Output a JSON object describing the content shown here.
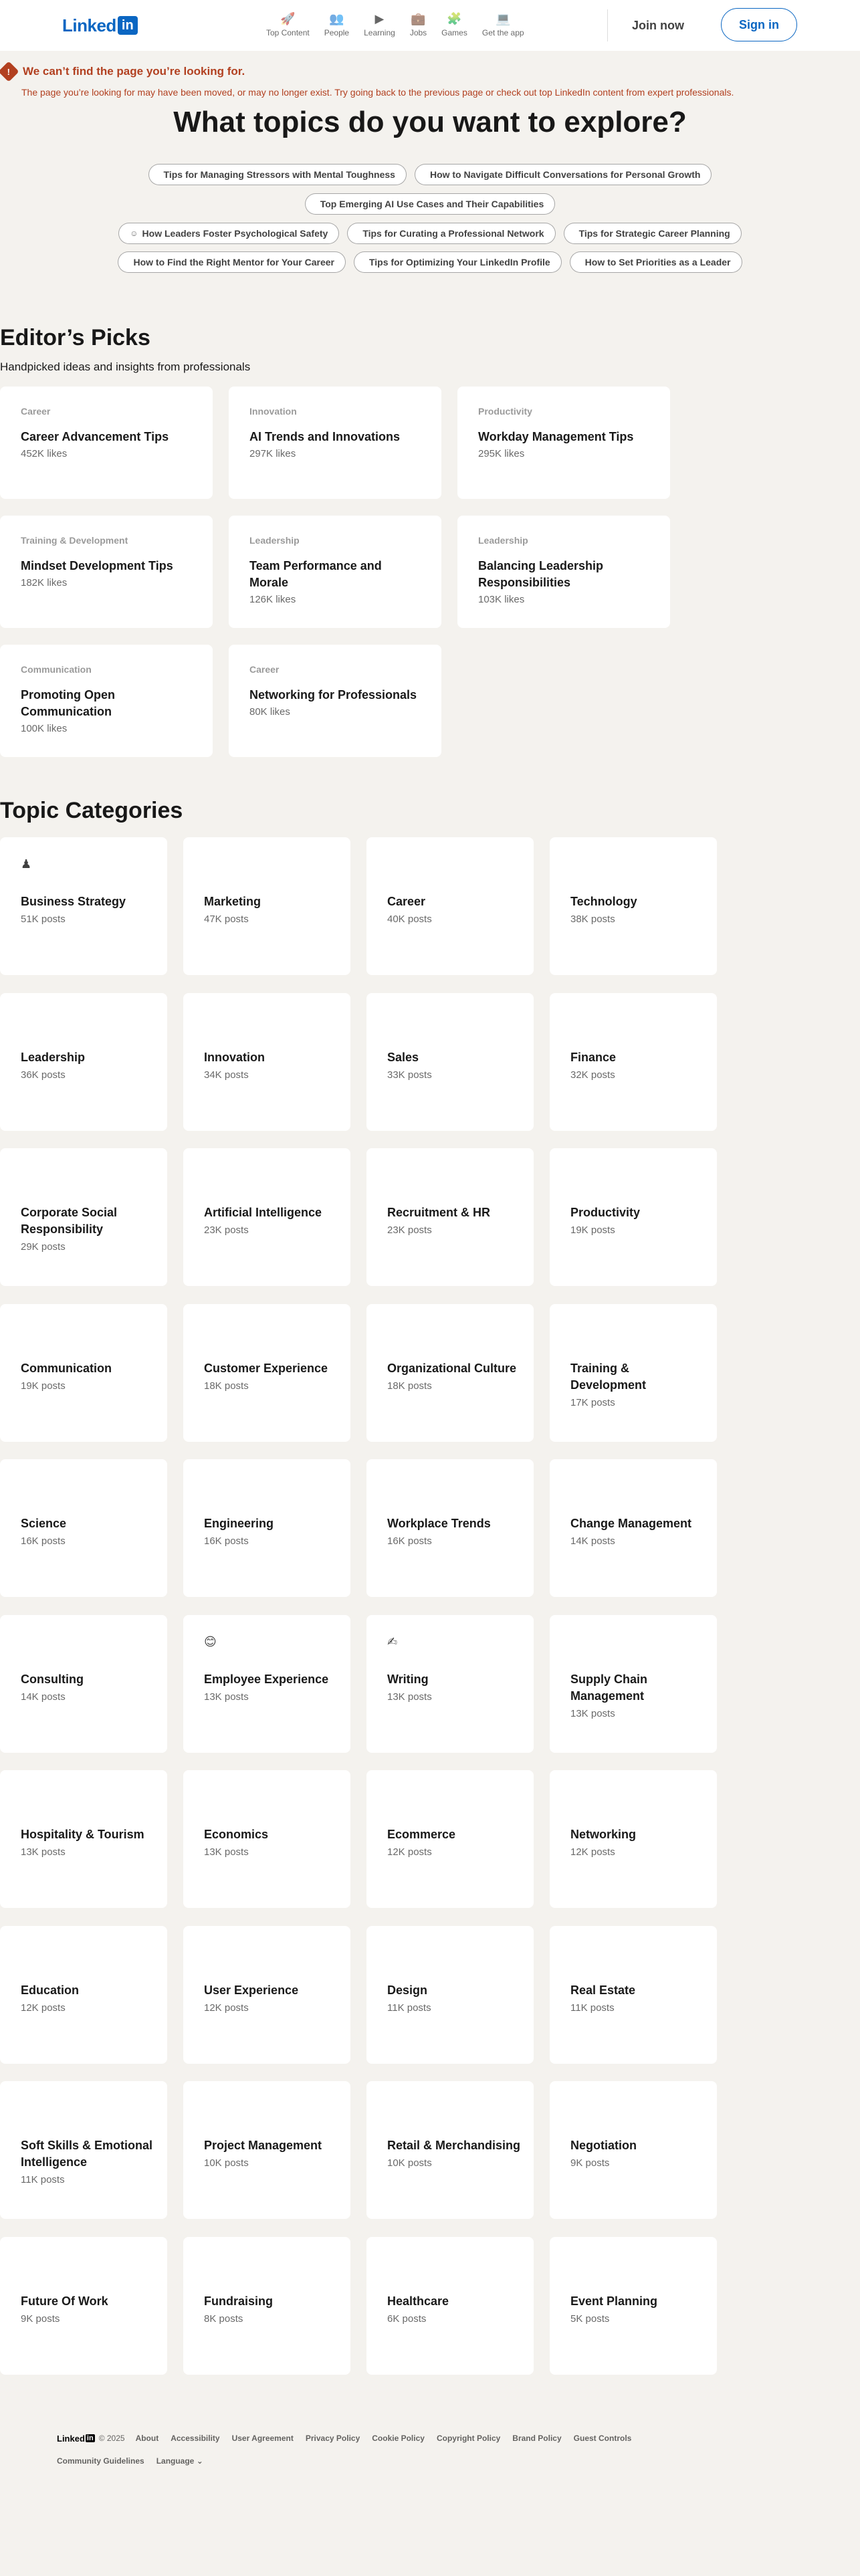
{
  "header": {
    "logo_text": "Linked",
    "logo_box": "in",
    "nav": [
      {
        "label": "Top Content",
        "icon": "rocket-icon",
        "glyph": "🚀"
      },
      {
        "label": "People",
        "icon": "people-icon",
        "glyph": "👥"
      },
      {
        "label": "Learning",
        "icon": "learning-icon",
        "glyph": "▶"
      },
      {
        "label": "Jobs",
        "icon": "briefcase-icon",
        "glyph": "💼"
      },
      {
        "label": "Games",
        "icon": "puzzle-icon",
        "glyph": "🧩"
      },
      {
        "label": "Get the app",
        "icon": "laptop-icon",
        "glyph": "💻"
      }
    ],
    "join_label": "Join now",
    "signin_label": "Sign in"
  },
  "error": {
    "badge": "!",
    "title": "We can’t find the page you’re looking for.",
    "message": "The page you’re looking for may have been moved, or may no longer exist. Try going back to the previous page or check out top LinkedIn content from expert professionals."
  },
  "explore": {
    "heading": "What topics do you want to explore?",
    "pills": [
      [
        "Tips for Managing Stressors with Mental Toughness",
        "How to Navigate Difficult Conversations for Personal Growth"
      ],
      [
        "Top Emerging AI Use Cases and Their Capabilities"
      ],
      [
        "How Leaders Foster Psychological Safety",
        "Tips for Curating a Professional Network",
        "Tips for Strategic Career Planning"
      ],
      [
        "How to Find the Right Mentor for Your Career",
        "Tips for Optimizing Your LinkedIn Profile",
        "How to Set Priorities as a Leader"
      ]
    ],
    "pill_icons": [
      [
        "",
        ""
      ],
      [
        ""
      ],
      [
        "☺",
        "",
        ""
      ],
      [
        "",
        "",
        ""
      ]
    ]
  },
  "editors_picks": {
    "title": "Editor’s Picks",
    "subtitle": "Handpicked ideas and insights from professionals",
    "bookmark_glyph": "",
    "cards": [
      {
        "category": "Career",
        "title": "Career Advancement Tips",
        "likes": "452K likes"
      },
      {
        "category": "Innovation",
        "title": "AI Trends and Innovations",
        "likes": "297K likes"
      },
      {
        "category": "Productivity",
        "title": "Workday Management Tips",
        "likes": "295K likes"
      },
      {
        "category": "Training & Development",
        "title": "Mindset Development Tips",
        "likes": "182K likes"
      },
      {
        "category": "Leadership",
        "title": "Team Performance and Morale",
        "likes": "126K likes"
      },
      {
        "category": "Leadership",
        "title": "Balancing Leadership Responsibilities",
        "likes": "103K likes"
      },
      {
        "category": "Communication",
        "title": "Promoting Open Communication",
        "likes": "100K likes"
      },
      {
        "category": "Career",
        "title": "Networking for Professionals",
        "likes": "80K likes"
      }
    ]
  },
  "topics": {
    "title": "Topic Categories",
    "items": [
      {
        "name": "Business Strategy",
        "posts": "51K posts",
        "glyph": "♟"
      },
      {
        "name": "Marketing",
        "posts": "47K posts",
        "glyph": ""
      },
      {
        "name": "Career",
        "posts": "40K posts",
        "glyph": ""
      },
      {
        "name": "Technology",
        "posts": "38K posts",
        "glyph": ""
      },
      {
        "name": "Leadership",
        "posts": "36K posts",
        "glyph": ""
      },
      {
        "name": "Innovation",
        "posts": "34K posts",
        "glyph": ""
      },
      {
        "name": "Sales",
        "posts": "33K posts",
        "glyph": ""
      },
      {
        "name": "Finance",
        "posts": "32K posts",
        "glyph": ""
      },
      {
        "name": "Corporate Social Responsibility",
        "posts": "29K posts",
        "glyph": ""
      },
      {
        "name": "Artificial Intelligence",
        "posts": "23K posts",
        "glyph": ""
      },
      {
        "name": "Recruitment & HR",
        "posts": "23K posts",
        "glyph": ""
      },
      {
        "name": "Productivity",
        "posts": "19K posts",
        "glyph": ""
      },
      {
        "name": "Communication",
        "posts": "19K posts",
        "glyph": ""
      },
      {
        "name": "Customer Experience",
        "posts": "18K posts",
        "glyph": ""
      },
      {
        "name": "Organizational Culture",
        "posts": "18K posts",
        "glyph": ""
      },
      {
        "name": "Training & Development",
        "posts": "17K posts",
        "glyph": ""
      },
      {
        "name": "Science",
        "posts": "16K posts",
        "glyph": ""
      },
      {
        "name": "Engineering",
        "posts": "16K posts",
        "glyph": ""
      },
      {
        "name": "Workplace Trends",
        "posts": "16K posts",
        "glyph": ""
      },
      {
        "name": "Change Management",
        "posts": "14K posts",
        "glyph": ""
      },
      {
        "name": "Consulting",
        "posts": "14K posts",
        "glyph": ""
      },
      {
        "name": "Employee Experience",
        "posts": "13K posts",
        "glyph": "😊"
      },
      {
        "name": "Writing",
        "posts": "13K posts",
        "glyph": "✍"
      },
      {
        "name": "Supply Chain Management",
        "posts": "13K posts",
        "glyph": ""
      },
      {
        "name": "Hospitality & Tourism",
        "posts": "13K posts",
        "glyph": ""
      },
      {
        "name": "Economics",
        "posts": "13K posts",
        "glyph": ""
      },
      {
        "name": "Ecommerce",
        "posts": "12K posts",
        "glyph": ""
      },
      {
        "name": "Networking",
        "posts": "12K posts",
        "glyph": ""
      },
      {
        "name": "Education",
        "posts": "12K posts",
        "glyph": ""
      },
      {
        "name": "User Experience",
        "posts": "12K posts",
        "glyph": ""
      },
      {
        "name": "Design",
        "posts": "11K posts",
        "glyph": ""
      },
      {
        "name": "Real Estate",
        "posts": "11K posts",
        "glyph": ""
      },
      {
        "name": "Soft Skills & Emotional Intelligence",
        "posts": "11K posts",
        "glyph": ""
      },
      {
        "name": "Project Management",
        "posts": "10K posts",
        "glyph": ""
      },
      {
        "name": "Retail & Merchandising",
        "posts": "10K posts",
        "glyph": ""
      },
      {
        "name": "Negotiation",
        "posts": "9K posts",
        "glyph": ""
      },
      {
        "name": "Future Of Work",
        "posts": "9K posts",
        "glyph": ""
      },
      {
        "name": "Fundraising",
        "posts": "8K posts",
        "glyph": ""
      },
      {
        "name": "Healthcare",
        "posts": "6K posts",
        "glyph": ""
      },
      {
        "name": "Event Planning",
        "posts": "5K posts",
        "glyph": ""
      }
    ]
  },
  "footer": {
    "logo_text": "Linked",
    "logo_box": "in",
    "copyright": "© 2025",
    "links_row1": [
      "About",
      "Accessibility",
      "User Agreement",
      "Privacy Policy",
      "Cookie Policy",
      "Copyright Policy",
      "Brand Policy",
      "Guest Controls"
    ],
    "links_row2": [
      "Community Guidelines"
    ],
    "language": "Language",
    "language_icon": "chevron-down-icon"
  },
  "colors": {
    "brand": "#0a66c2",
    "error": "#b24020",
    "background": "#f4f2ee",
    "card": "#ffffff"
  }
}
